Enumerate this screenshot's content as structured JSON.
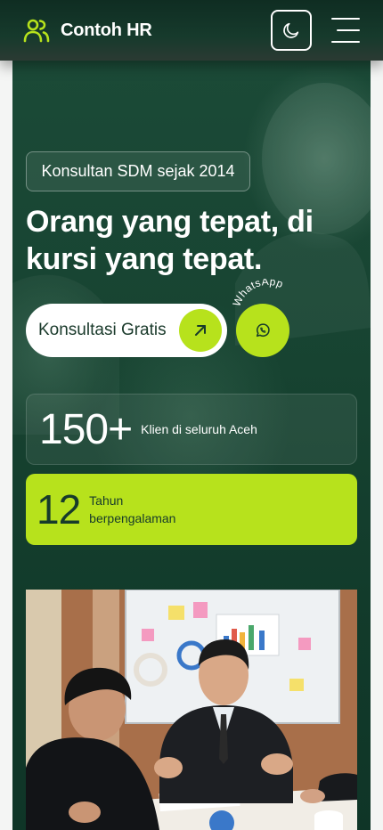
{
  "header": {
    "brand": "Contoh HR",
    "brand_icon": "users-icon",
    "theme_icon": "moon-icon",
    "menu_icon": "hamburger-menu-icon",
    "accent_color": "#b7e21c"
  },
  "hero": {
    "badge": "Konsultan SDM sejak 2014",
    "headline": "Orang yang tepat, di kursi yang tepat.",
    "cta_label": "Konsultasi Gratis",
    "cta_icon": "arrow-up-right-icon",
    "whatsapp_label": "WhatsApp",
    "whatsapp_icon": "whatsapp-icon"
  },
  "stats": [
    {
      "value": "150+",
      "label": "Klien di seluruh Aceh"
    },
    {
      "value": "12",
      "label": "Tahun berpengalaman"
    }
  ],
  "photo": {
    "subject": "business-meeting-photo"
  }
}
